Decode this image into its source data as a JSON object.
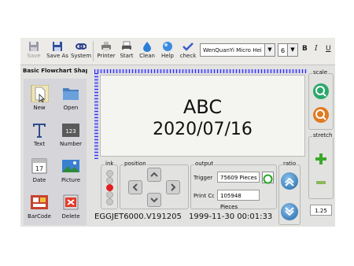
{
  "toolbar": {
    "buttons": [
      {
        "label": "Save",
        "icon": "floppy-disk-icon",
        "disabled": true
      },
      {
        "label": "Save As",
        "icon": "floppy-disk-icon"
      },
      {
        "label": "System",
        "icon": "link-icon"
      },
      {
        "label": "Printer",
        "icon": "printer-icon"
      },
      {
        "label": "Start",
        "icon": "print-start-icon"
      },
      {
        "label": "Clean",
        "icon": "droplet-icon"
      },
      {
        "label": "Help",
        "icon": "globe-help-icon"
      },
      {
        "label": "check",
        "icon": "check-icon"
      }
    ],
    "font_family": "WenQuanYi Micro Hei",
    "font_size": "6",
    "bold": "B",
    "italic": "I",
    "underline": "U"
  },
  "sidebar": {
    "title": "Basic Flowchart Shap",
    "tools": [
      {
        "label": "New",
        "icon": "new-document-icon"
      },
      {
        "label": "Open",
        "icon": "folder-icon"
      },
      {
        "label": "Text",
        "icon": "text-icon"
      },
      {
        "label": "Number",
        "icon": "number-icon"
      },
      {
        "label": "Date",
        "icon": "calendar-icon"
      },
      {
        "label": "Picture",
        "icon": "picture-icon"
      },
      {
        "label": "BarCode",
        "icon": "barcode-icon"
      },
      {
        "label": "Delete",
        "icon": "delete-icon"
      }
    ]
  },
  "canvas": {
    "line1": "ABC",
    "line2": "2020/07/16"
  },
  "ink": {
    "label": "ink",
    "active_color": "#e02020",
    "level": "3 of 5"
  },
  "position": {
    "label": "position"
  },
  "output": {
    "label": "output",
    "trigger_label": "Trigger C",
    "trigger_value": "75609  Pieces",
    "print_label": "Print Cou",
    "print_value": "105948  Pieces"
  },
  "ratio": {
    "label": "ratio",
    "value": "1.25"
  },
  "scale": {
    "label": "scale"
  },
  "stretch": {
    "label": "stretch"
  },
  "status": {
    "version": "EGGJET6000.V191205",
    "datetime": "1999-11-30 00:01:33"
  },
  "colors": {
    "accent": "#1f66a8",
    "green": "#3aa82a",
    "orange": "#e07a20"
  }
}
